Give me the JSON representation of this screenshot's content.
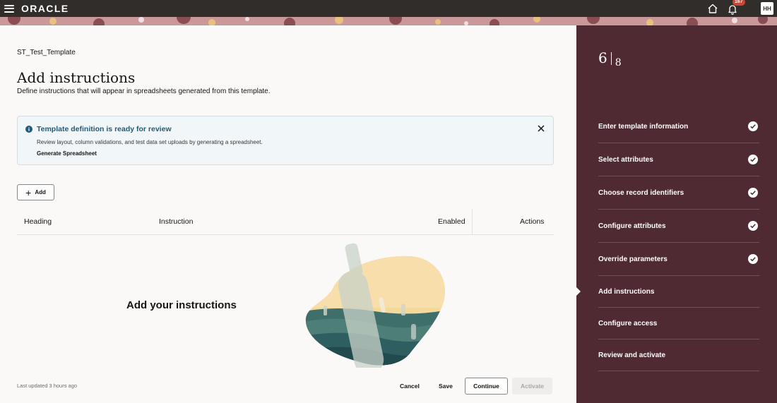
{
  "header": {
    "logo": "ORACLE",
    "notification_count": "167",
    "avatar_initials": "HH"
  },
  "main": {
    "template_name": "ST_Test_Template",
    "title": "Add instructions",
    "subtitle": "Define instructions that will appear in spreadsheets generated from this template.",
    "message": {
      "title": "Template definition is ready for review",
      "body": "Review layout, column validations, and test data set uploads by generating a spreadsheet.",
      "link": "Generate Spreadsheet"
    },
    "add_label": "Add",
    "table": {
      "columns": [
        "Heading",
        "Instruction",
        "Enabled",
        "Actions"
      ]
    },
    "empty_state": "Add your instructions"
  },
  "footer": {
    "last_updated": "Last updated 3 hours ago",
    "cancel": "Cancel",
    "save": "Save",
    "continue": "Continue",
    "activate": "Activate"
  },
  "sidebar": {
    "current_step": "6",
    "total_steps": "8",
    "steps": [
      {
        "label": "Enter template information",
        "done": true
      },
      {
        "label": "Select attributes",
        "done": true
      },
      {
        "label": "Choose record identifiers",
        "done": true
      },
      {
        "label": "Configure attributes",
        "done": true
      },
      {
        "label": "Override parameters",
        "done": true
      },
      {
        "label": "Add instructions",
        "done": false,
        "current": true
      },
      {
        "label": "Configure access",
        "done": false
      },
      {
        "label": "Review and activate",
        "done": false
      }
    ]
  },
  "colors": {
    "topbar": "#312d2a",
    "sidebar": "#4f2a33",
    "info_title": "#1f5b7a",
    "badge": "#c74634"
  }
}
